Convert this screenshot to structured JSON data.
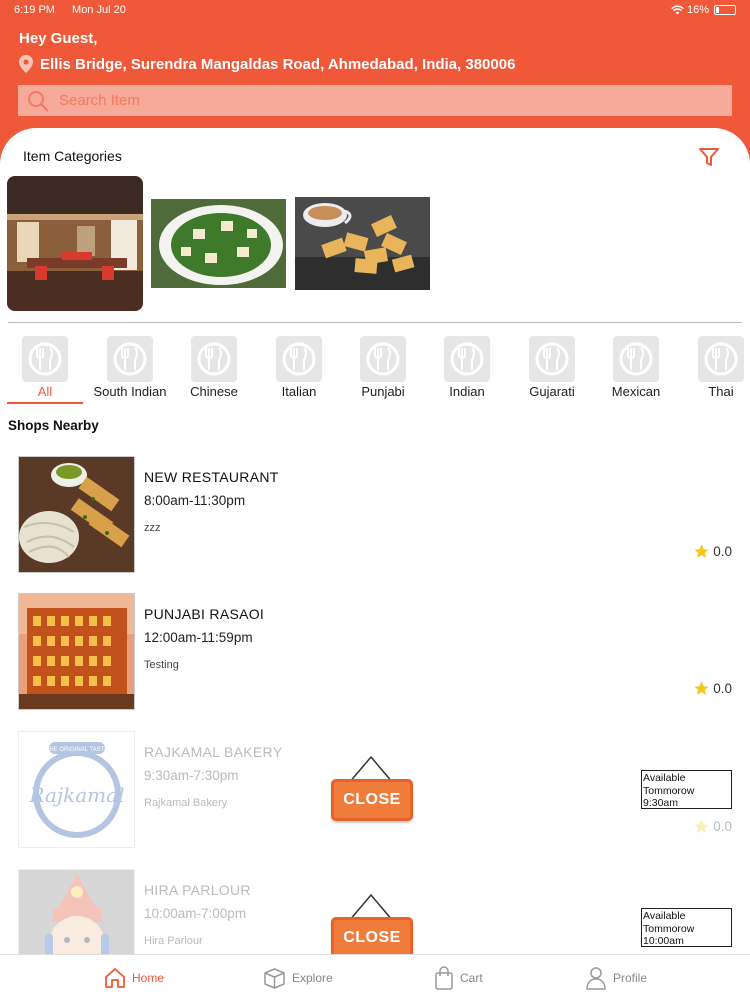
{
  "status": {
    "time": "6:19 PM",
    "date": "Mon Jul 20",
    "battery_label": "16%",
    "battery_level": 0.16
  },
  "header": {
    "greeting": "Hey Guest,",
    "address": "Ellis Bridge, Surendra Mangaldas Road, Ahmedabad, India, 380006",
    "search_placeholder": "Search Item"
  },
  "categories": {
    "title": "Item Categories"
  },
  "chips": [
    {
      "label": "All"
    },
    {
      "label": "South Indian"
    },
    {
      "label": "Chinese"
    },
    {
      "label": "Italian"
    },
    {
      "label": "Punjabi"
    },
    {
      "label": "Indian"
    },
    {
      "label": "Gujarati"
    },
    {
      "label": "Mexican"
    },
    {
      "label": "Thai"
    }
  ],
  "shops_title": "Shops Nearby",
  "shops": [
    {
      "name": "NEW RESTAURANT",
      "hours": "8:00am-11:30pm",
      "desc": "zzz",
      "rating": "0.0"
    },
    {
      "name": "PUNJABI RASAOI",
      "hours": "12:00am-11:59pm",
      "desc": "Testing",
      "rating": "0.0"
    },
    {
      "name": "RAJKAMAL BAKERY",
      "hours": "9:30am-7:30pm",
      "desc": "Rajkamal Bakery",
      "rating": "0.0",
      "close_label": "CLOSE",
      "availability": [
        "Available",
        "Tommorow",
        "9:30am"
      ],
      "logo_text": "Rajkamal",
      "logo_subtext": "THE ORIGINAL TASTE"
    },
    {
      "name": "HIRA PARLOUR",
      "hours": "10:00am-7:00pm",
      "desc": "Hira Parlour",
      "close_label": "CLOSE",
      "availability": [
        "Available",
        "Tommorow",
        "10:00am"
      ]
    }
  ],
  "nav": {
    "home": "Home",
    "explore": "Explore",
    "cart": "Cart",
    "profile": "Profile"
  },
  "colors": {
    "brand": "#f0583a",
    "close_sign": "#f07c3c",
    "star": "#f5c518"
  }
}
